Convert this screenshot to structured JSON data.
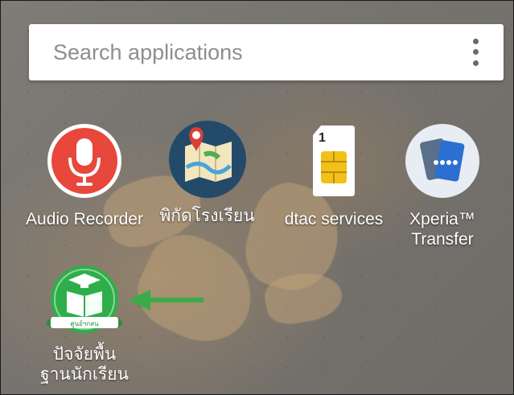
{
  "search": {
    "placeholder": "Search applications",
    "menu_icon": "overflow-menu-icon"
  },
  "apps": [
    {
      "label": "Audio Recorder",
      "icon": "microphone-icon",
      "color": "#e8473b"
    },
    {
      "label": "พิกัดโรงเรียน",
      "icon": "map-pin-icon",
      "color": "#244a69"
    },
    {
      "label": "dtac services",
      "icon": "sim-card-icon",
      "badge": "1",
      "color": "#f2c018"
    },
    {
      "label_lines": [
        "Xperia™",
        "Transfer"
      ],
      "icon": "phone-transfer-icon",
      "color": "#2b6fd0"
    },
    {
      "label_lines": [
        "ปัจจัยพื้น",
        "ฐานนักเรียน"
      ],
      "icon": "graduation-book-icon",
      "badge_text": "ศูนย์ฯกสน",
      "color": "#2eae4a"
    }
  ],
  "annotation": {
    "icon": "left-arrow-icon",
    "color": "#3daa4a"
  }
}
